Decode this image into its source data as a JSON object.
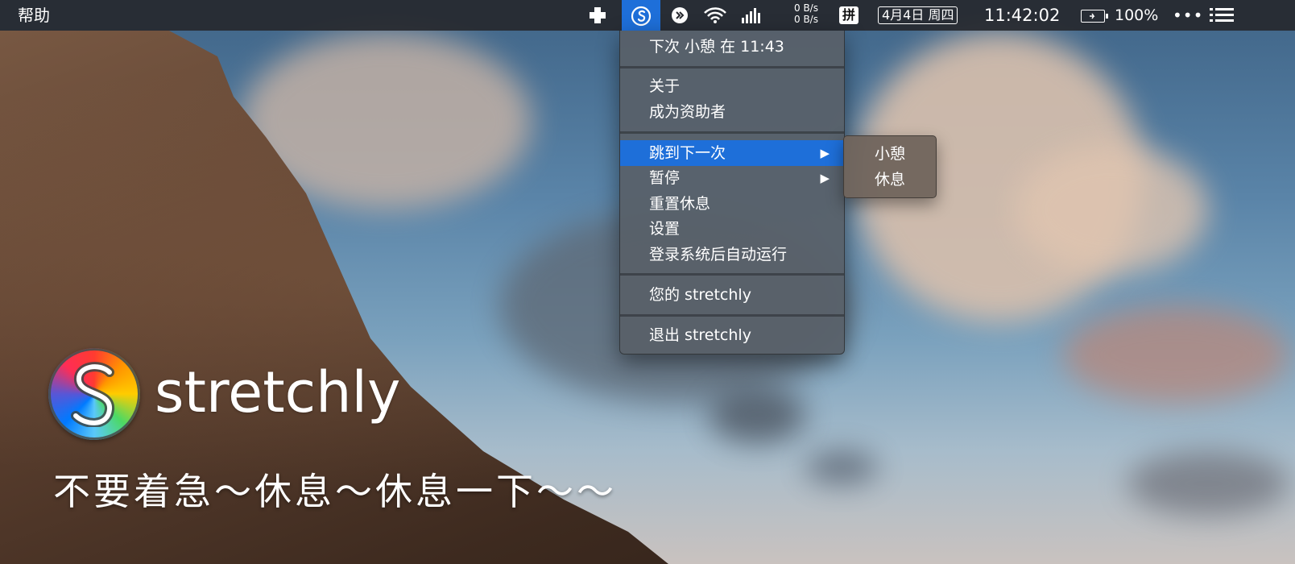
{
  "menubar": {
    "app_menu": "帮助",
    "net_speed_up": "0 B/s",
    "net_speed_down": "0 B/s",
    "ime": "拼",
    "date": "4月4日 周四",
    "clock": "11:42:02",
    "battery": "100%",
    "more": "•••"
  },
  "menu": {
    "next_break": "下次 小憩 在 11:43",
    "about": "关于",
    "sponsor": "成为资助者",
    "skip_to_next": "跳到下一次",
    "pause": "暂停",
    "reset_breaks": "重置休息",
    "settings": "设置",
    "run_at_login": "登录系统后自动运行",
    "your_stretchly": "您的 stretchly",
    "quit": "退出 stretchly",
    "arrow": "▶"
  },
  "submenu": {
    "mini_break": "小憩",
    "long_break": "休息"
  },
  "branding": {
    "app_name": "stretchly",
    "tagline": "不要着急～休息～休息一下～～"
  },
  "colors": {
    "highlight": "#1e6fd9",
    "menubar": "#26282e"
  }
}
